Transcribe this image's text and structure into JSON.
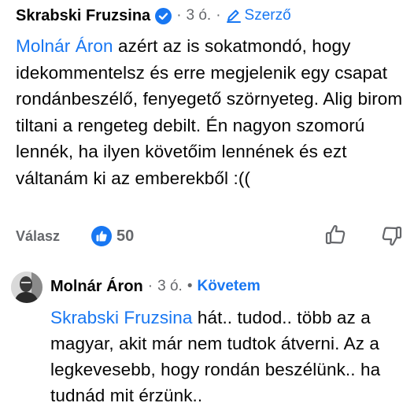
{
  "comment1": {
    "author": "Skrabski Fruzsina",
    "time": "3 ó.",
    "role": "Szerző",
    "mention": "Molnár Áron",
    "text": "azért az is sokatmondó, hogy idekommentelsz és erre megjelenik egy csapat rondánbeszélő, fenyegető szörnyeteg. Alig birom tiltani a rengeteg debilt. Én nagyon szomorú lennék, ha ilyen követőim lennének és ezt váltanám ki az emberekből :((",
    "reply_label": "Válasz",
    "like_count": "50"
  },
  "comment2": {
    "author": "Molnár Áron",
    "time": "3 ó.",
    "follow_label": "Követem",
    "mention": "Skrabski Fruzsina",
    "text": "hát.. tudod.. több az a magyar, akit már nem tudtok átverni. Az a legkevesebb, hogy rondán beszélünk.. ha tudnád mit érzünk.."
  },
  "colors": {
    "accent": "#1877f2",
    "muted": "#65676b",
    "text": "#050505"
  }
}
